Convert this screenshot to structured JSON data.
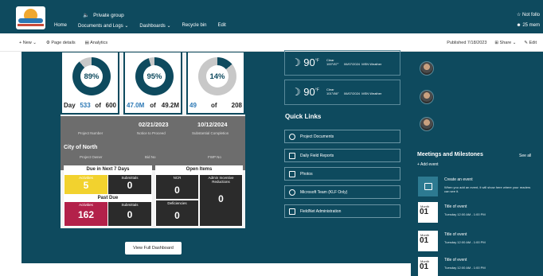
{
  "header": {
    "group_label": "Private group",
    "nav": [
      "Home",
      "Documents and Logs",
      "Dashboards",
      "Recycle bin",
      "Edit"
    ],
    "follow_label": "Not follo",
    "members_label": "25 mem"
  },
  "command_bar": {
    "new_label": "New",
    "page_details_label": "Page details",
    "analytics_label": "Analytics",
    "published_label": "Published 7/18/2023",
    "share_label": "Share",
    "edit_label": "Edit"
  },
  "dashboard": {
    "kpis": [
      {
        "percent": 89,
        "percent_text": "89%",
        "left": "Day",
        "num": "533",
        "of": "of",
        "total": "600",
        "color": "#0e4a5e"
      },
      {
        "percent": 95,
        "percent_text": "95%",
        "left": "",
        "num": "47.0M",
        "of": "of",
        "total": "49.2M",
        "color": "#0e4a5e"
      },
      {
        "percent": 14,
        "percent_text": "14%",
        "left": "",
        "num": "49",
        "of": "of",
        "total": "208",
        "color": "#0e4a5e"
      }
    ],
    "dates": {
      "ntp_date": "02/21/2023",
      "completion_date": "10/12/2024",
      "project_number_label": "Project Number",
      "ntp_label": "Notice to Proceed",
      "completion_label": "Substantial Completion",
      "owner_name": "City of North",
      "owner_label": "Project Owner",
      "bid_label": "Bid No",
      "fwp_label": "FWP No"
    },
    "due": {
      "title": "Due in Next 7 Days",
      "activities_label": "Activities",
      "activities_value": "5",
      "submittals_label": "Submittals",
      "submittals_value": "0",
      "past_due_title": "Past Due",
      "pd_activities_label": "Activities",
      "pd_activities_value": "162",
      "pd_submittals_label": "Submittals",
      "pd_submittals_value": "0"
    },
    "open_items": {
      "title": "Open Items",
      "ncr_label": "NCR",
      "ncr_value": "0",
      "admin_label": "Admin Incentive Reductions",
      "admin_value": "0",
      "deficiencies_label": "Deficiencies",
      "deficiencies_value": "0"
    },
    "view_full_label": "View Full Dashboard"
  },
  "weather": [
    {
      "temp": "90",
      "unit": "°F",
      "condition": "Clear",
      "range": "100°/87°",
      "date": "06/07/2024",
      "source": "MSN Weather"
    },
    {
      "temp": "90",
      "unit": "°F",
      "condition": "Clear",
      "range": "101°/86°",
      "date": "06/07/2024",
      "source": "MSN Weather"
    }
  ],
  "quick_links": {
    "title": "Quick Links",
    "items": [
      {
        "label": "Project Documents",
        "icon": "globe-icon"
      },
      {
        "label": "Daily Field Reports",
        "icon": "document-icon"
      },
      {
        "label": "Photos",
        "icon": "image-icon"
      },
      {
        "label": "Microsoft Team (KLF Only)",
        "icon": "globe-icon"
      },
      {
        "label": "FieldNet Administration",
        "icon": "document-icon"
      }
    ]
  },
  "meetings": {
    "title": "Meetings and Milestones",
    "see_all": "See all",
    "add_event": "+ Add event",
    "create_title": "Create an event",
    "create_desc": "When you add an event, it will show here where your readers can see it.",
    "events": [
      {
        "month": "Month",
        "day": "01",
        "title": "Title of event",
        "time": "Tuesday 12:00 AM - 1:00 PM"
      },
      {
        "month": "Month",
        "day": "01",
        "title": "Title of event",
        "time": "Tuesday 12:00 AM - 1:00 PM"
      },
      {
        "month": "Month",
        "day": "01",
        "title": "Title of event",
        "time": "Tuesday 12:00 AM - 1:00 PM"
      }
    ]
  },
  "colors": {
    "brand": "#0e4a5e",
    "activities_yellow": "#f2d22e",
    "past_due_red": "#b3214a",
    "ring_track": "#c8c8c8"
  }
}
